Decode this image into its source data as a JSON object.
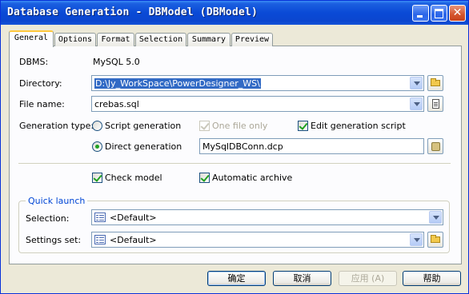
{
  "window": {
    "title": "Database Generation - DBModel (DBModel)"
  },
  "tabs": [
    "General",
    "Options",
    "Format",
    "Selection",
    "Summary",
    "Preview"
  ],
  "general": {
    "dbms_label": "DBMS:",
    "dbms_value": "MySQL 5.0",
    "directory_label": "Directory:",
    "directory_value": "D:\\Jy_WorkSpace\\PowerDesigner_WS\\",
    "filename_label": "File name:",
    "filename_value": "crebas.sql",
    "gentype_label": "Generation type:",
    "script_generation_label": "Script generation",
    "one_file_only_label": "One file only",
    "edit_generation_script_label": "Edit generation script",
    "direct_generation_label": "Direct generation",
    "connection_value": "MySqlDBConn.dcp",
    "check_model_label": "Check model",
    "automatic_archive_label": "Automatic archive",
    "script_generation_selected": false,
    "direct_generation_selected": true,
    "one_file_only_checked": true,
    "edit_generation_script_checked": true,
    "check_model_checked": true,
    "automatic_archive_checked": true
  },
  "quick_launch": {
    "title": "Quick launch",
    "selection_label": "Selection:",
    "selection_value": "<Default>",
    "settings_label": "Settings set:",
    "settings_value": "<Default>"
  },
  "buttons": {
    "ok": "确定",
    "cancel": "取消",
    "apply": "应用 (A)",
    "help": "帮助"
  },
  "colors": {
    "titlebar": "#0a4ad6",
    "accent": "#316ac5",
    "check_green": "#21a121"
  }
}
